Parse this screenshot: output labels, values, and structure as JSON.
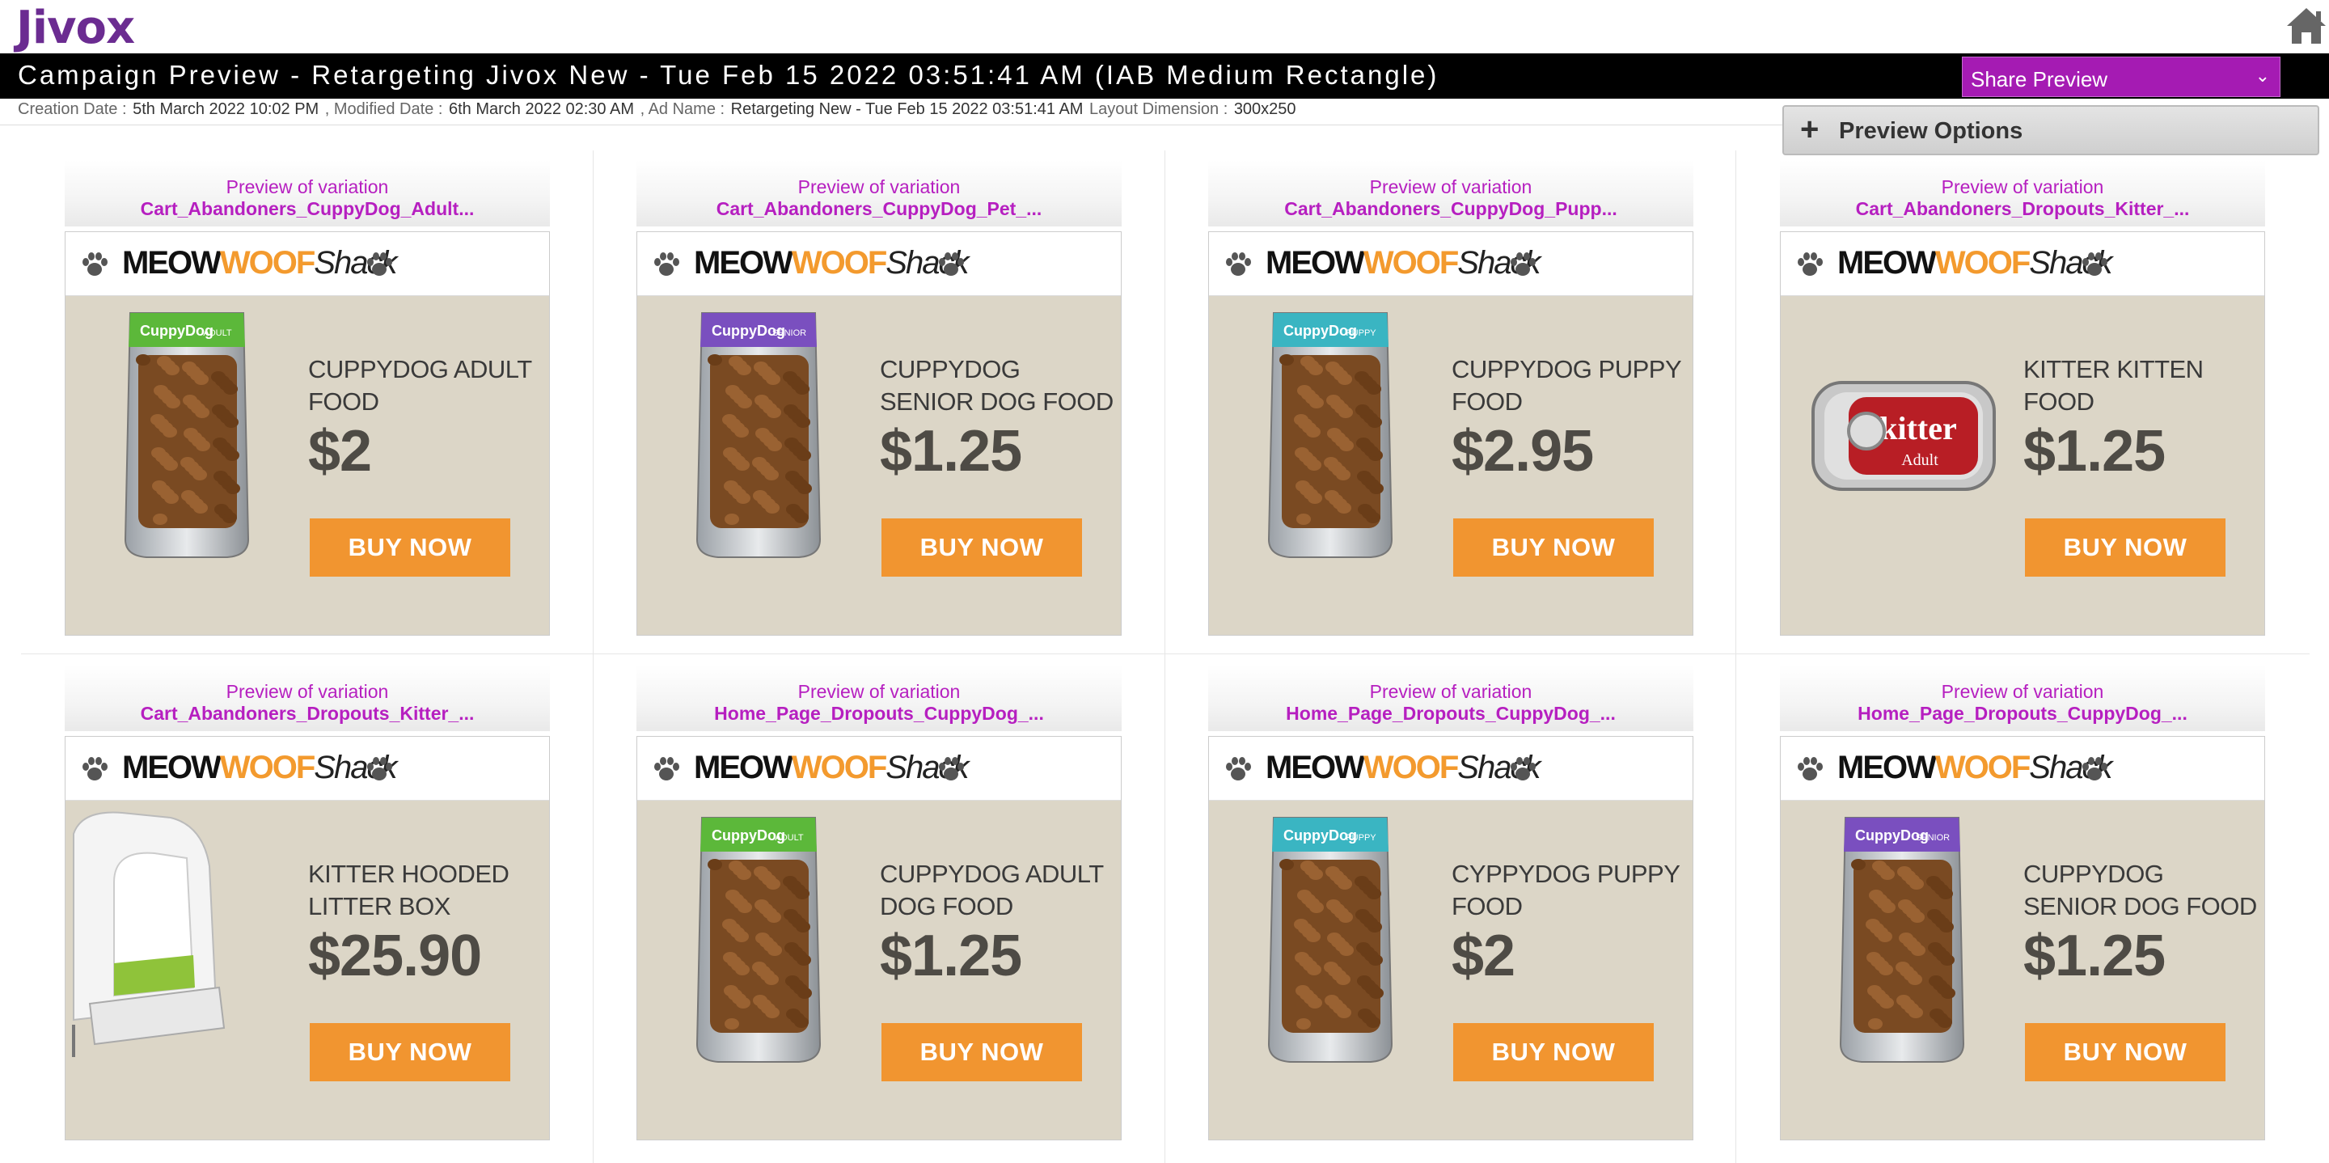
{
  "header": {
    "logo": "Jivox",
    "home_icon": "home-icon"
  },
  "titlebar": {
    "title": "Campaign Preview - Retargeting Jivox New - Tue Feb 15 2022 03:51:41 AM (IAB Medium Rectangle)",
    "share_select": "Share Preview"
  },
  "info": {
    "creation_label": "Creation Date : ",
    "creation_value": "5th March 2022 10:02 PM",
    "modified_label": " ,  Modified Date : ",
    "modified_value": " 6th March 2022 02:30 AM",
    "adname_label": " , Ad Name : ",
    "adname_value": "Retargeting New - Tue Feb 15 2022 03:51:41 AM",
    "layout_label": "  Layout Dimension : ",
    "layout_value": "300x250"
  },
  "preview_options": {
    "plus": "+",
    "label": "Preview Options"
  },
  "brand": {
    "meow": "MEOW",
    "woof": "WOOF",
    "shack": "Shack"
  },
  "cards": [
    {
      "preview_label": "Preview of variation",
      "variation": "Cart_Abandoners_CuppyDog_Adult...",
      "product": "CUPPYDOG ADULT FOOD",
      "price": "$2",
      "buy": "BUY NOW",
      "image": "bag",
      "bag_label": "CuppyDog",
      "bag_tag": "ADULT",
      "bag_color": "#5cb83a"
    },
    {
      "preview_label": "Preview of variation",
      "variation": "Cart_Abandoners_CuppyDog_Pet_...",
      "product": "CUPPYDOG SENIOR DOG FOOD",
      "price": "$1.25",
      "buy": "BUY NOW",
      "image": "bag",
      "bag_label": "CuppyDog",
      "bag_tag": "SENIOR",
      "bag_color": "#7a4fbf"
    },
    {
      "preview_label": "Preview of variation",
      "variation": "Cart_Abandoners_CuppyDog_Pupp...",
      "product": "CUPPYDOG PUPPY FOOD",
      "price": "$2.95",
      "buy": "BUY NOW",
      "image": "bag",
      "bag_label": "CuppyDog",
      "bag_tag": "PUPPY",
      "bag_color": "#3ab5c2"
    },
    {
      "preview_label": "Preview of variation",
      "variation": "Cart_Abandoners_Dropouts_Kitter_...",
      "product": "KITTER KITTEN FOOD",
      "price": "$1.25",
      "buy": "BUY NOW",
      "image": "can",
      "can_label": "kitter",
      "can_tag": "Adult"
    },
    {
      "preview_label": "Preview of variation",
      "variation": "Cart_Abandoners_Dropouts_Kitter_...",
      "product": "KITTER HOODED LITTER BOX",
      "price": "$25.90",
      "buy": "BUY NOW",
      "image": "litter"
    },
    {
      "preview_label": "Preview of variation",
      "variation": "Home_Page_Dropouts_CuppyDog_...",
      "product": "CUPPYDOG ADULT DOG FOOD",
      "price": "$1.25",
      "buy": "BUY NOW",
      "image": "bag",
      "bag_label": "CuppyDog",
      "bag_tag": "ADULT",
      "bag_color": "#5cb83a"
    },
    {
      "preview_label": "Preview of variation",
      "variation": "Home_Page_Dropouts_CuppyDog_...",
      "product": "CYPPYDOG PUPPY FOOD",
      "price": "$2",
      "buy": "BUY NOW",
      "image": "bag",
      "bag_label": "CuppyDog",
      "bag_tag": "PUPPY",
      "bag_color": "#3ab5c2"
    },
    {
      "preview_label": "Preview of variation",
      "variation": "Home_Page_Dropouts_CuppyDog_...",
      "product": "CUPPYDOG SENIOR DOG FOOD",
      "price": "$1.25",
      "buy": "BUY NOW",
      "image": "bag",
      "bag_label": "CuppyDog",
      "bag_tag": "SENIOR",
      "bag_color": "#7a4fbf"
    }
  ],
  "colors": {
    "accent": "#a51bb3",
    "variation_text": "#b61fc0",
    "buy_button": "#f19530",
    "ad_bg": "#dcd6c7"
  }
}
